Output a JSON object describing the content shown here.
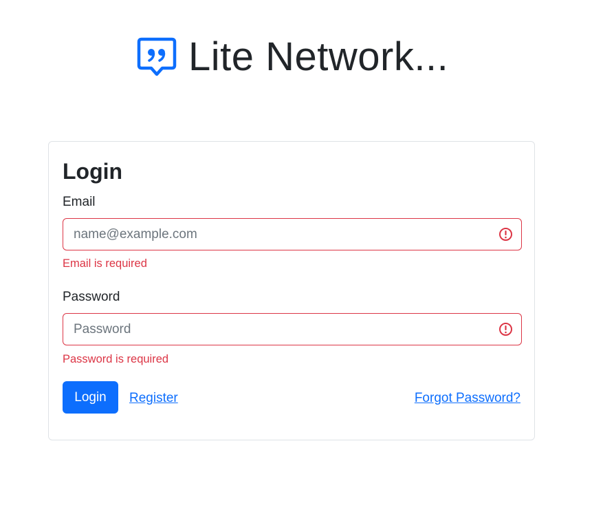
{
  "brand": {
    "icon": "quote-chat-icon",
    "title": "Lite Network...",
    "accent_color": "#0d6efd"
  },
  "login_card": {
    "title": "Login",
    "email": {
      "label": "Email",
      "value": "",
      "placeholder": "name@example.com",
      "error": "Email is required"
    },
    "password": {
      "label": "Password",
      "value": "",
      "placeholder": "Password",
      "error": "Password is required"
    },
    "login_button": "Login",
    "register_link": "Register",
    "forgot_link": "Forgot Password?",
    "error_color": "#dc3545"
  }
}
